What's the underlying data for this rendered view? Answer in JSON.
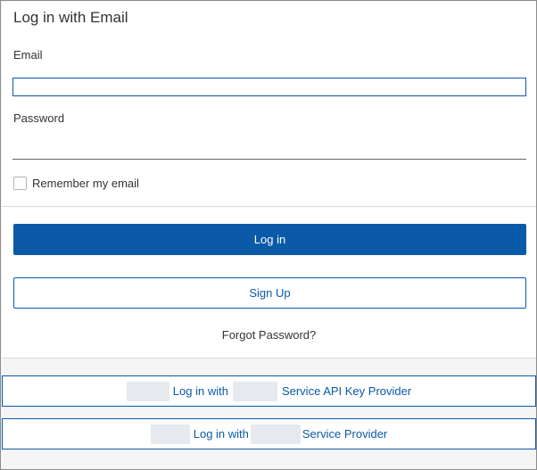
{
  "login": {
    "title": "Log in with Email",
    "email_label": "Email",
    "email_value": "",
    "password_label": "Password",
    "password_value": "",
    "remember_label": "Remember my email",
    "remember_checked": false,
    "login_button": "Log in",
    "signup_button": "Sign Up",
    "forgot_link": "Forgot Password?"
  },
  "sso": {
    "api_key_provider": {
      "prefix": "Log in with",
      "suffix": "Service API Key Provider"
    },
    "service_provider": {
      "prefix": "Log in with",
      "suffix": "Service Provider"
    }
  },
  "colors": {
    "accent": "#0a5aa8",
    "text": "#333333",
    "panel_bg": "#f5f5f5"
  }
}
